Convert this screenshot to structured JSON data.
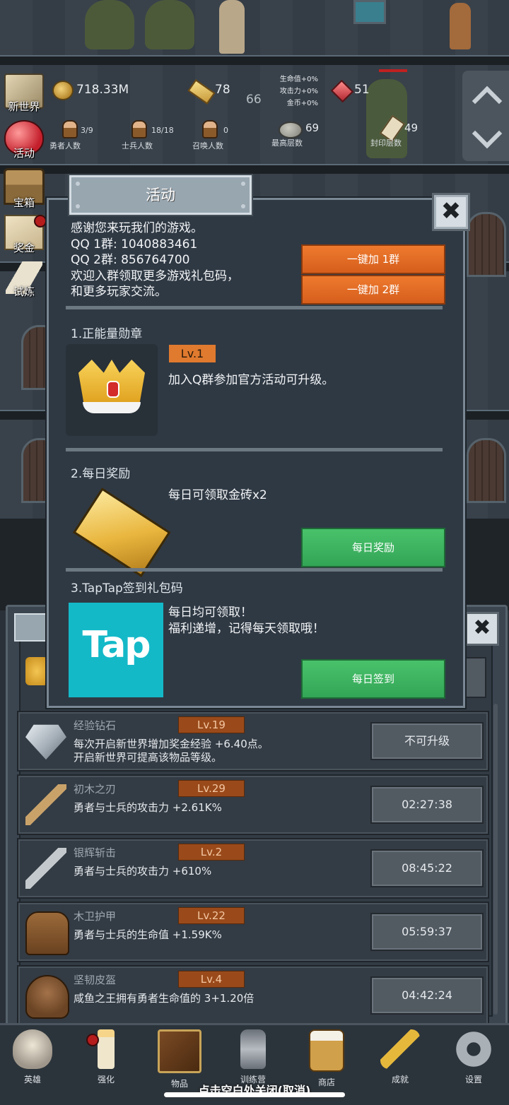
{
  "top_stats": {
    "gold": "718.33M",
    "gold_bars": "78",
    "floor_indicator": "66",
    "bonus_hp": "生命值+0%",
    "bonus_atk": "攻击力+0%",
    "bonus_gold": "金币+0%",
    "gems": "51",
    "heroes": {
      "value": "3/9",
      "label": "勇者人数"
    },
    "soldiers": {
      "value": "18/18",
      "label": "士兵人数"
    },
    "summons": {
      "value": "0",
      "label": "召唤人数"
    },
    "highest_floor": {
      "value": "69",
      "label": "最高层数"
    },
    "sealed_floor": {
      "value": "49",
      "label": "封印层数"
    }
  },
  "sidebar": [
    {
      "label": "新世界",
      "icon": "map-icon"
    },
    {
      "label": "活动",
      "icon": "heart-icon"
    },
    {
      "label": "宝箱",
      "icon": "chest-icon"
    },
    {
      "label": "奖金",
      "icon": "envelope-icon"
    },
    {
      "label": "试炼",
      "icon": "feather-icon"
    }
  ],
  "dialog": {
    "title": "活动",
    "intro": {
      "thanks": "感谢您来玩我们的游戏。",
      "qq1": "QQ 1群: 1040883461",
      "qq2": "QQ 2群: 856764700",
      "join": "欢迎入群领取更多游戏礼包码，",
      "chat": "和更多玩家交流。",
      "join1_btn": "一键加 1群",
      "join2_btn": "一键加 2群"
    },
    "section1": {
      "title": "1.正能量勋章",
      "level": "Lv.1",
      "desc": "加入Q群参加官方活动可升级。"
    },
    "section2": {
      "title": "2.每日奖励",
      "desc": "每日可领取金砖x2",
      "button": "每日奖励"
    },
    "section3": {
      "title": "3.TapTap签到礼包码",
      "line1": "每日均可领取！",
      "line2": "福利递增，记得每天领取哦！",
      "logo_text": "Tap",
      "button": "每日签到"
    }
  },
  "items": [
    {
      "name": "经验钻石",
      "level": "Lv.19",
      "desc1": "每次开启新世界增加奖金经验 +6.40点。",
      "desc2": "开启新世界可提高该物品等级。",
      "button": "不可升级",
      "icon": "diamond-icon"
    },
    {
      "name": "初木之刃",
      "level": "Lv.29",
      "desc1": "勇者与士兵的攻击力 +2.61K%",
      "desc2": "",
      "button": "02:27:38",
      "icon": "wooden-sword-icon"
    },
    {
      "name": "银辉斩击",
      "level": "Lv.2",
      "desc1": "勇者与士兵的攻击力 +610%",
      "desc2": "",
      "button": "08:45:22",
      "icon": "silver-sword-icon"
    },
    {
      "name": "木卫护甲",
      "level": "Lv.22",
      "desc1": "勇者与士兵的生命值 +1.59K%",
      "desc2": "",
      "button": "05:59:37",
      "icon": "armor-icon"
    },
    {
      "name": "坚韧皮盔",
      "level": "Lv.4",
      "desc1": "咸鱼之王拥有勇者生命值的 3+1.20倍",
      "desc2": "",
      "button": "04:42:24",
      "icon": "helmet-icon"
    }
  ],
  "nav": [
    {
      "label": "英雄",
      "icon": "skull-icon"
    },
    {
      "label": "强化",
      "icon": "candle-icon"
    },
    {
      "label": "物品",
      "icon": "book-icon"
    },
    {
      "label": "训练营",
      "icon": "lantern-icon"
    },
    {
      "label": "商店",
      "icon": "beer-icon"
    },
    {
      "label": "成就",
      "icon": "key-icon"
    },
    {
      "label": "设置",
      "icon": "gear-icon"
    }
  ],
  "footer_hint": "点击空白处关闭(取消)",
  "colors": {
    "accent_orange": "#e07a2e",
    "accent_green": "#3fb561",
    "taptap_blue": "#14b9c8"
  }
}
